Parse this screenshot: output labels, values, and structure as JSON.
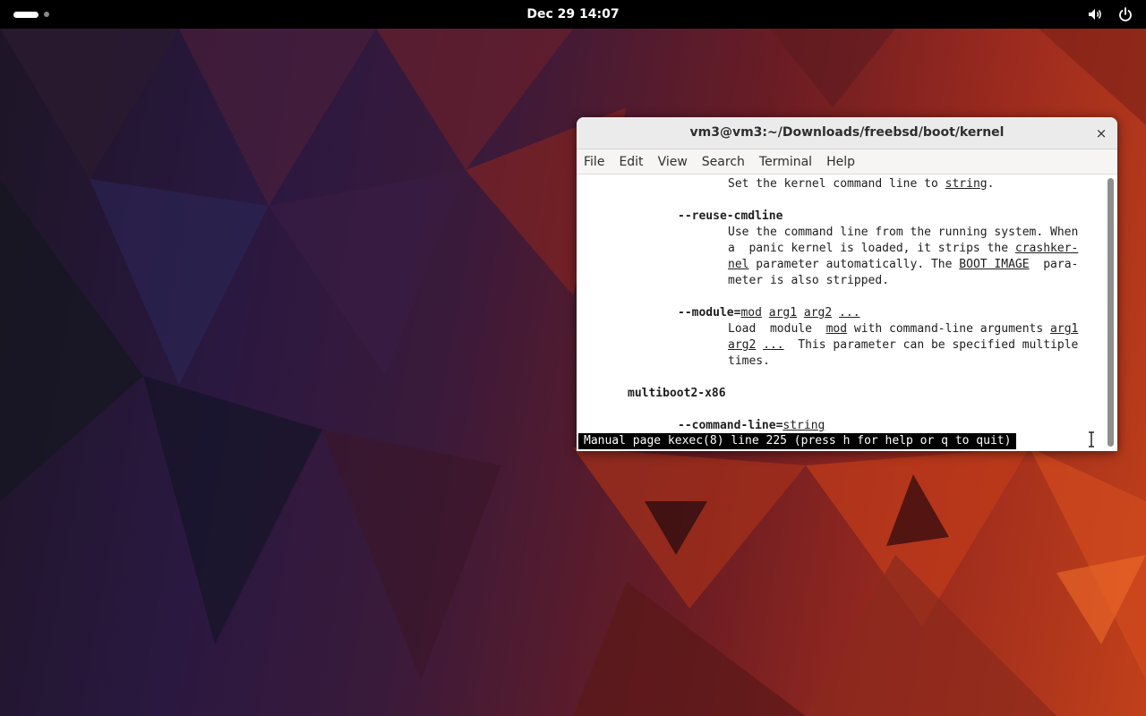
{
  "topbar": {
    "clock": "Dec 29  14:07",
    "icons": [
      "activities-indicator",
      "volume-icon",
      "power-icon"
    ]
  },
  "window": {
    "title": "vm3@vm3:~/Downloads/freebsd/boot/kernel",
    "close_glyph": "×",
    "menu": [
      "File",
      "Edit",
      "View",
      "Search",
      "Terminal",
      "Help"
    ]
  },
  "terminal": {
    "lines": [
      {
        "indent": 21,
        "parts": [
          {
            "t": "Set the kernel command line to "
          },
          {
            "t": "string",
            "u": true
          },
          {
            "t": "."
          }
        ]
      },
      {
        "indent": 0,
        "parts": []
      },
      {
        "indent": 14,
        "parts": [
          {
            "t": "--reuse-cmdline",
            "b": true
          }
        ]
      },
      {
        "indent": 21,
        "parts": [
          {
            "t": "Use the command line from the running system. When"
          }
        ]
      },
      {
        "indent": 21,
        "parts": [
          {
            "t": "a  panic kernel is loaded, it strips the "
          },
          {
            "t": "crashker-",
            "u": true
          }
        ]
      },
      {
        "indent": 21,
        "parts": [
          {
            "t": "nel",
            "u": true
          },
          {
            "t": " parameter automatically. The "
          },
          {
            "t": "BOOT IMAGE",
            "u": true
          },
          {
            "t": "  para-"
          }
        ]
      },
      {
        "indent": 21,
        "parts": [
          {
            "t": "meter is also stripped."
          }
        ]
      },
      {
        "indent": 0,
        "parts": []
      },
      {
        "indent": 14,
        "parts": [
          {
            "t": "--module=",
            "b": true
          },
          {
            "t": "mod",
            "u": true
          },
          {
            "t": " "
          },
          {
            "t": "arg1",
            "u": true
          },
          {
            "t": " "
          },
          {
            "t": "arg2",
            "u": true
          },
          {
            "t": " "
          },
          {
            "t": "...",
            "u": true
          }
        ]
      },
      {
        "indent": 21,
        "parts": [
          {
            "t": "Load  module  "
          },
          {
            "t": "mod",
            "u": true
          },
          {
            "t": " with command-line arguments "
          },
          {
            "t": "arg1",
            "u": true
          }
        ]
      },
      {
        "indent": 21,
        "parts": [
          {
            "t": "arg2",
            "u": true
          },
          {
            "t": " "
          },
          {
            "t": "...",
            "u": true
          },
          {
            "t": "  This parameter can be specified multiple"
          }
        ]
      },
      {
        "indent": 21,
        "parts": [
          {
            "t": "times."
          }
        ]
      },
      {
        "indent": 0,
        "parts": []
      },
      {
        "indent": 7,
        "parts": [
          {
            "t": "multiboot2-x86",
            "b": true
          }
        ]
      },
      {
        "indent": 0,
        "parts": []
      },
      {
        "indent": 14,
        "parts": [
          {
            "t": "--command-line=",
            "b": true
          },
          {
            "t": "string",
            "u": true
          }
        ]
      }
    ],
    "status": "Manual page kexec(8) line 225 (press h for help or q to quit)"
  }
}
